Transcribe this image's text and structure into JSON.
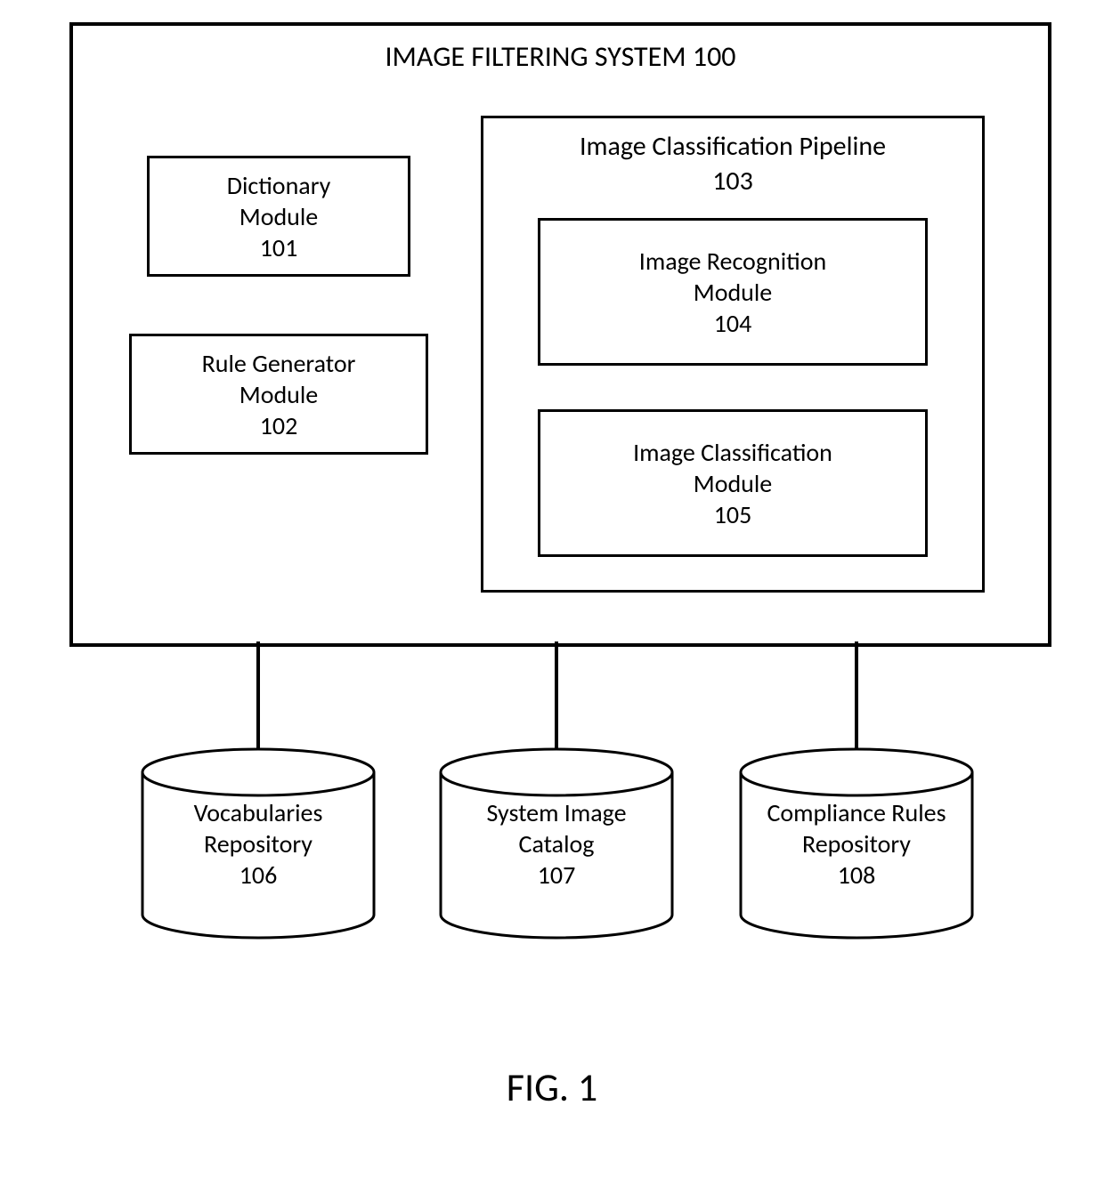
{
  "system": {
    "title": "IMAGE FILTERING SYSTEM 100"
  },
  "modules": {
    "dictionary": {
      "name": "Dictionary",
      "label": "Module",
      "id": "101"
    },
    "rule": {
      "name": "Rule Generator",
      "label": "Module",
      "id": "102"
    },
    "pipeline": {
      "name": "Image Classification Pipeline",
      "id": "103"
    },
    "recognition": {
      "name": "Image Recognition",
      "label": "Module",
      "id": "104"
    },
    "classification": {
      "name": "Image Classification",
      "label": "Module",
      "id": "105"
    }
  },
  "repos": {
    "vocab": {
      "name": "Vocabularies",
      "label": "Repository",
      "id": "106"
    },
    "catalog": {
      "name": "System Image",
      "label": "Catalog",
      "id": "107"
    },
    "rules": {
      "name": "Compliance Rules",
      "label": "Repository",
      "id": "108"
    }
  },
  "figure": {
    "label": "FIG. 1"
  }
}
